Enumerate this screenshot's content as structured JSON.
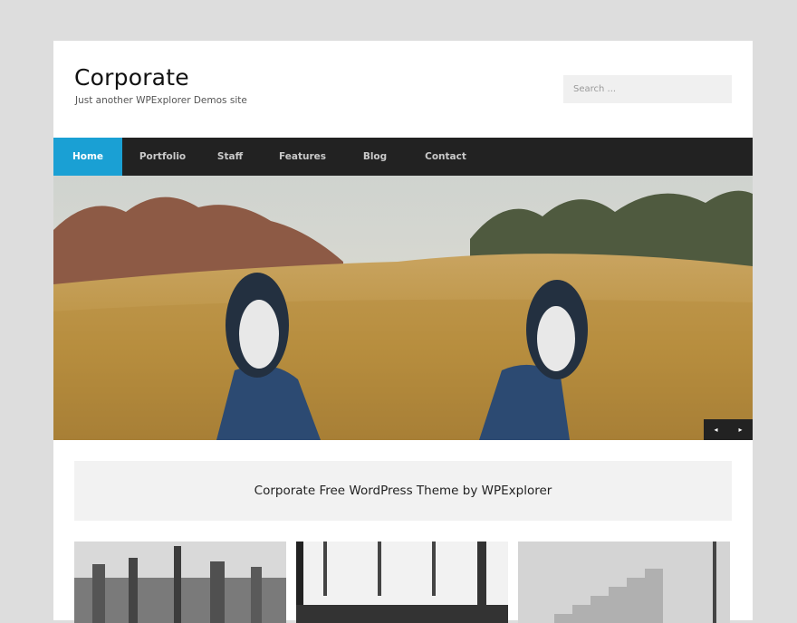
{
  "site": {
    "title": "Corporate",
    "tagline": "Just another WPExplorer Demos site"
  },
  "search": {
    "placeholder": "Search ..."
  },
  "nav": {
    "items": [
      {
        "label": "Home",
        "active": true
      },
      {
        "label": "Portfolio",
        "active": false
      },
      {
        "label": "Staff",
        "active": false
      },
      {
        "label": "Features",
        "active": false
      },
      {
        "label": "Blog",
        "active": false
      },
      {
        "label": "Contact",
        "active": false
      }
    ]
  },
  "slider": {
    "prev_icon": "◂",
    "next_icon": "▸"
  },
  "banner": {
    "text": "Corporate Free WordPress Theme by WPExplorer"
  },
  "colors": {
    "accent": "#1aa0d4",
    "nav_bg": "#222222",
    "page_bg": "#dddddd"
  }
}
